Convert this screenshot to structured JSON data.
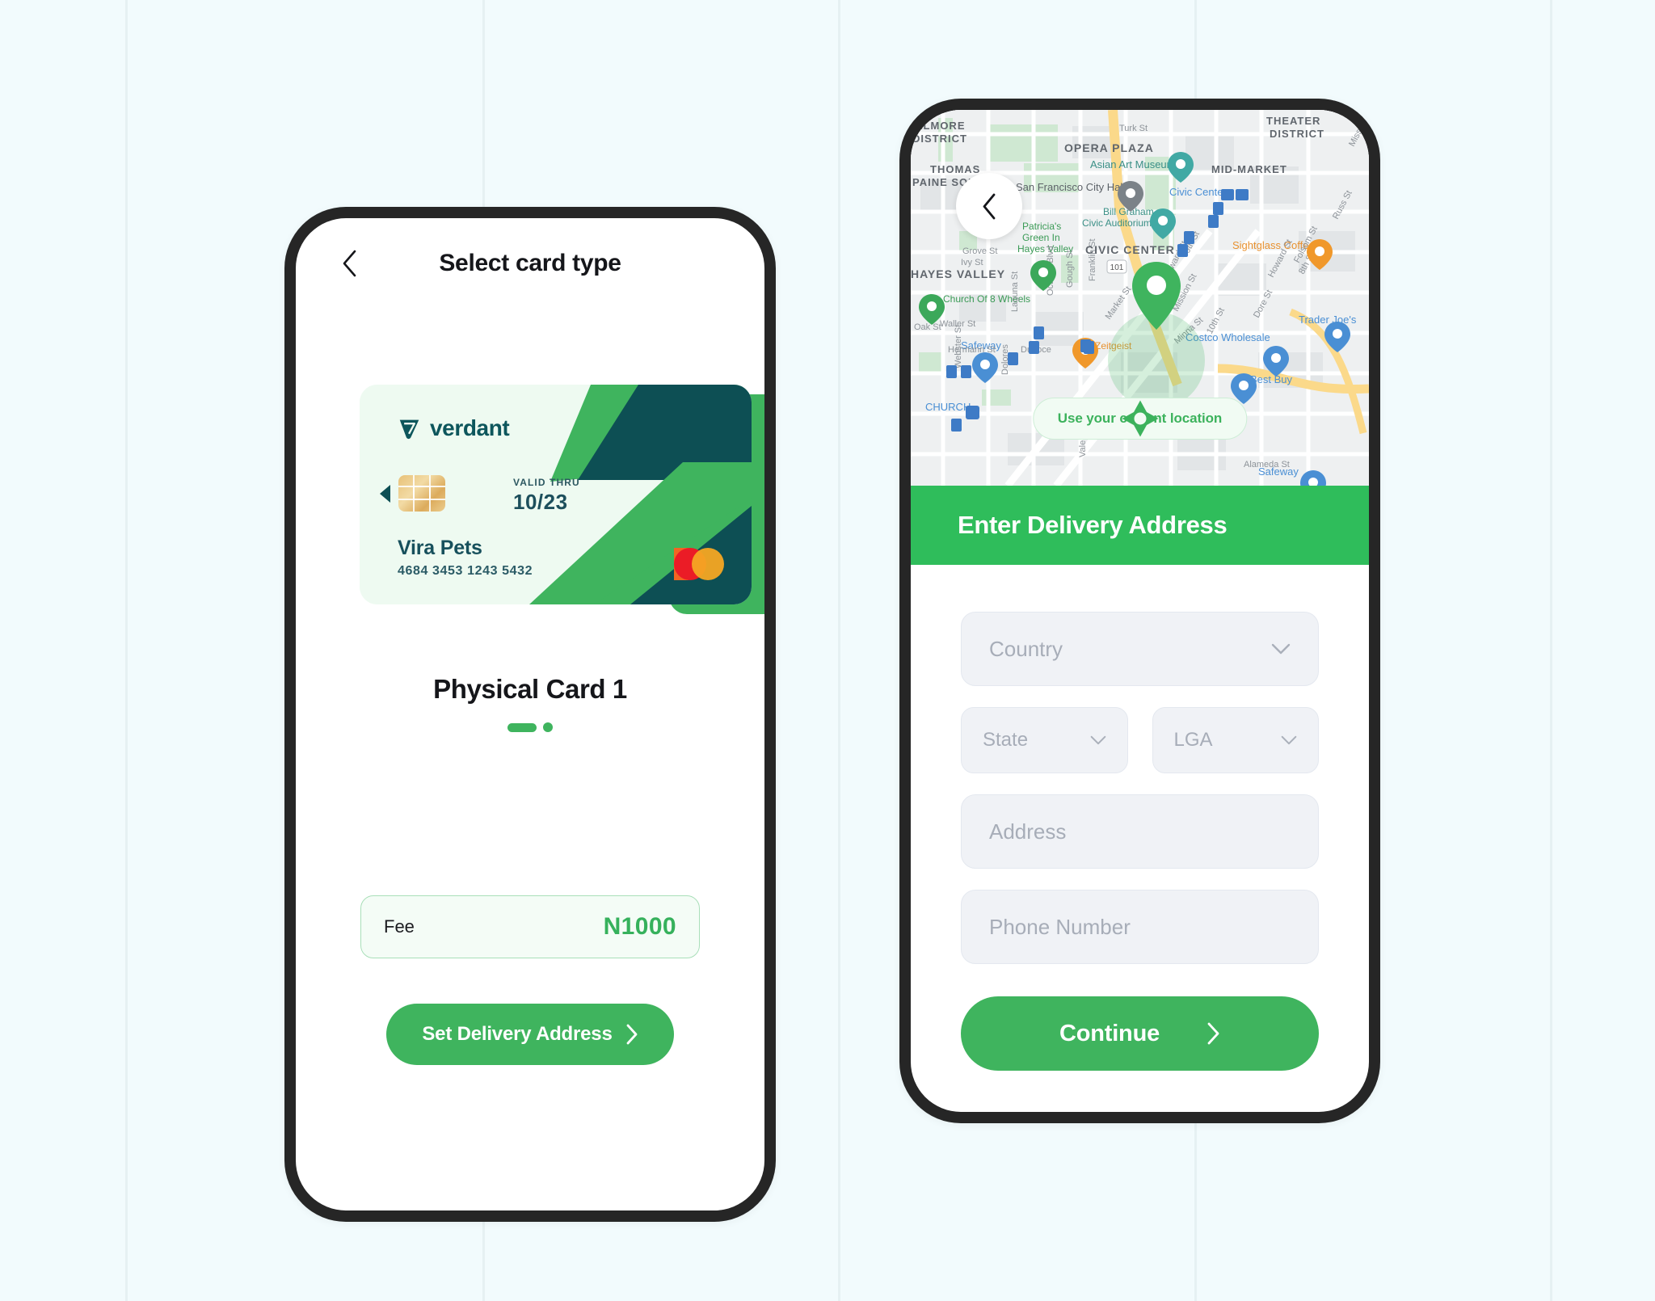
{
  "theme": {
    "page_bg": "#f2fbfd",
    "brand_green": "#3fb45e",
    "header_green": "#2fbd5b",
    "dark_teal": "#0d565c",
    "phone_bezel": "#262626"
  },
  "left_phone": {
    "nav": {
      "back_icon": "chevron-left-icon",
      "title": "Select card type"
    },
    "card": {
      "brand_name": "verdant",
      "brand_mark": "verdant-logo-icon",
      "chip_icon": "emv-chip-icon",
      "prev_arrow_icon": "triangle-left-icon",
      "valid_thru_label": "VALID THRU",
      "valid_thru_value": "10/23",
      "holder_name": "Vira Pets",
      "card_number": "4684 3453 1243 5432",
      "network_icon": "mastercard-logo-icon"
    },
    "card_name": "Physical Card 1",
    "pagination": {
      "total": 2,
      "active_index": 0
    },
    "fee": {
      "label": "Fee",
      "value": "N1000"
    },
    "cta": {
      "label": "Set Delivery Address",
      "icon": "chevron-right-icon"
    }
  },
  "right_phone": {
    "map": {
      "back_icon": "chevron-left-icon",
      "pin_icon": "location-pin-icon",
      "current_location": {
        "label": "Use your current location",
        "icon": "crosshair-location-icon"
      },
      "district_labels": [
        "ILLMORE DISTRICT",
        "THOMAS PAINE SQUARE",
        "HAYES VALLEY",
        "OPERA PLAZA",
        "CIVIC CENTER",
        "MID-MARKET",
        "THEATER DISTRICT",
        "CHURCH"
      ],
      "place_labels": [
        "Asian Art Museum",
        "San Francisco City Hall",
        "Bill Graham Civic Auditorium",
        "Patricia's Green In Hayes Valley",
        "Church Of 8 Wheels",
        "Civic Center",
        "Sightglass Coffee",
        "Trader Joe's",
        "Costco Wholesale",
        "Best Buy",
        "Zeitgeist",
        "Safeway",
        "Safeway"
      ],
      "street_labels": [
        "Turk St",
        "Grove St",
        "Ivy St",
        "Oak St",
        "Franklin St",
        "Gough St",
        "Octavia Blvd",
        "Laguna St",
        "Webster St",
        "Market St",
        "Mission St",
        "Minna St",
        "9th St",
        "10th St",
        "8th St",
        "Howard St",
        "Folsom St",
        "Dore St",
        "Russ St",
        "Waller St",
        "Hermann St",
        "Duboce",
        "Dolores",
        "Valencia",
        "Alameda St",
        "101"
      ]
    },
    "header": {
      "title": "Enter Delivery Address"
    },
    "form": {
      "country": {
        "placeholder": "Country",
        "value": "",
        "chevron": "chevron-down-icon"
      },
      "state": {
        "placeholder": "State",
        "value": "",
        "chevron": "chevron-down-icon"
      },
      "lga": {
        "placeholder": "LGA",
        "value": "",
        "chevron": "chevron-down-icon"
      },
      "address": {
        "placeholder": "Address",
        "value": ""
      },
      "phone": {
        "placeholder": "Phone Number",
        "value": ""
      }
    },
    "continue": {
      "label": "Continue",
      "icon": "chevron-right-icon"
    }
  }
}
